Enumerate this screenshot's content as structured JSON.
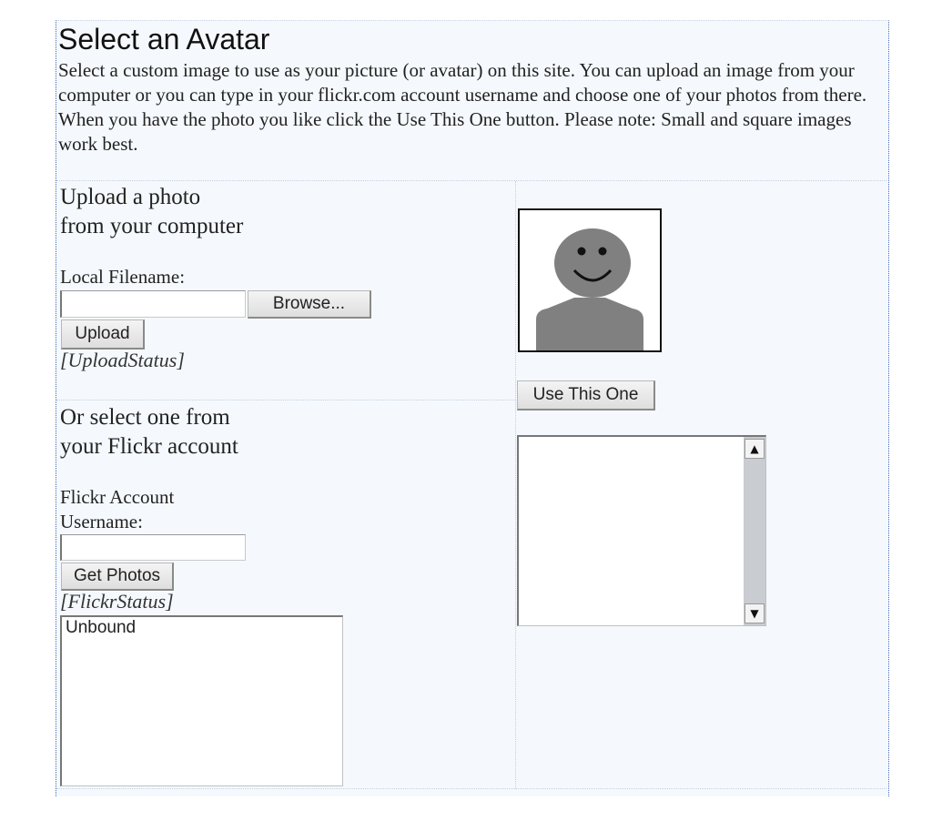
{
  "page": {
    "title": "Select an Avatar",
    "intro": "Select a custom image to use as your picture (or avatar) on this site. You can upload an image from your computer or you can type in your flickr.com account username and choose one of your photos from there. When you have the photo you like click the Use This One button. Please note: Small and square images work best."
  },
  "upload": {
    "heading_line1": "Upload a photo",
    "heading_line2": "from your computer",
    "filename_label": "Local Filename:",
    "filename_value": "",
    "browse_label": "Browse...",
    "upload_label": "Upload",
    "status": "[UploadStatus]"
  },
  "flickr": {
    "heading_line1": "Or select one from",
    "heading_line2": "your Flickr account",
    "account_label_line1": "Flickr Account",
    "account_label_line2": "Username:",
    "username_value": "",
    "get_photos_label": "Get Photos",
    "status": "[FlickrStatus]",
    "list_items": [
      "Unbound"
    ]
  },
  "preview": {
    "use_button_label": "Use This One",
    "photo_list_items": []
  },
  "icons": {
    "avatar": "default-avatar-silhouette",
    "scroll_up": "up-arrow-icon",
    "scroll_down": "down-arrow-icon"
  },
  "colors": {
    "panel_background": "#f5f9fd",
    "avatar_gray": "#7f7f7f"
  }
}
